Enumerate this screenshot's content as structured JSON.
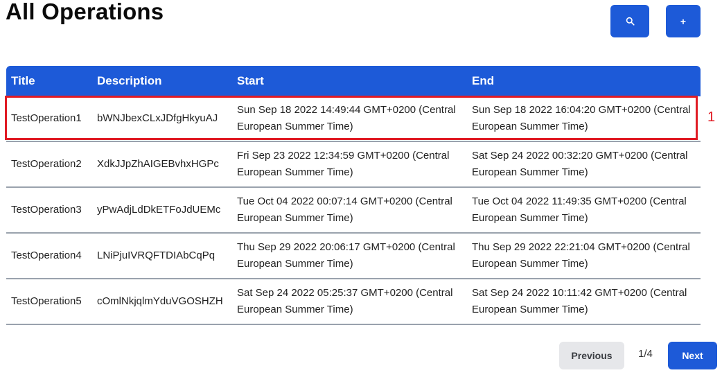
{
  "header": {
    "title": "All Operations",
    "search_icon": "search-icon",
    "add_icon": "plus-icon",
    "add_label": "+"
  },
  "table": {
    "columns": [
      "Title",
      "Description",
      "Start",
      "End"
    ],
    "rows": [
      {
        "title": "TestOperation1",
        "description": "bWNJbexCLxJDfgHkyuAJ",
        "start": "Sun Sep 18 2022 14:49:44 GMT+0200 (Central European Summer Time)",
        "end": "Sun Sep 18 2022 16:04:20 GMT+0200 (Central European Summer Time)"
      },
      {
        "title": "TestOperation2",
        "description": "XdkJJpZhAIGEBvhxHGPc",
        "start": "Fri Sep 23 2022 12:34:59 GMT+0200 (Central European Summer Time)",
        "end": "Sat Sep 24 2022 00:32:20 GMT+0200 (Central European Summer Time)"
      },
      {
        "title": "TestOperation3",
        "description": "yPwAdjLdDkETFoJdUEMc",
        "start": "Tue Oct 04 2022 00:07:14 GMT+0200 (Central European Summer Time)",
        "end": "Tue Oct 04 2022 11:49:35 GMT+0200 (Central European Summer Time)"
      },
      {
        "title": "TestOperation4",
        "description": "LNiPjuIVRQFTDIAbCqPq",
        "start": "Thu Sep 29 2022 20:06:17 GMT+0200 (Central European Summer Time)",
        "end": "Thu Sep 29 2022 22:21:04 GMT+0200 (Central European Summer Time)"
      },
      {
        "title": "TestOperation5",
        "description": "cOmlNkjqlmYduVGOSHZH",
        "start": "Sat Sep 24 2022 05:25:37 GMT+0200 (Central European Summer Time)",
        "end": "Sat Sep 24 2022 10:11:42 GMT+0200 (Central European Summer Time)"
      }
    ]
  },
  "annotation": {
    "label": "1",
    "color": "#e01b24"
  },
  "pagination": {
    "previous_label": "Previous",
    "page_indicator": "1/4",
    "next_label": "Next"
  },
  "colors": {
    "accent": "#1d5ad8",
    "secondary_button": "#e6e7ea",
    "row_divider": "#9aa2ad"
  }
}
